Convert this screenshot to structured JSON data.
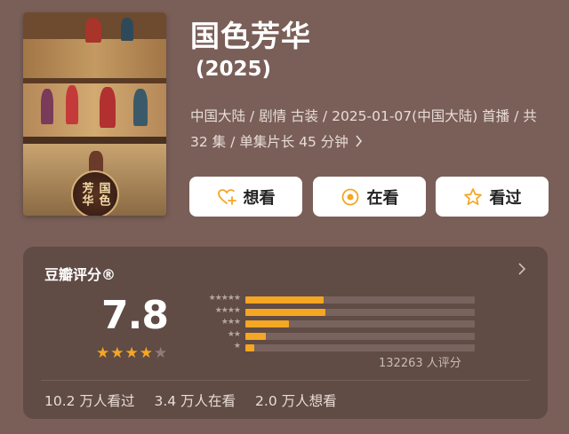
{
  "movie": {
    "title": "国色芳华",
    "year": "(2025)",
    "meta_line": "中国大陆 / 剧情 古装 / 2025-01-07(中国大陆) 首播 / 共 32 集 / 单集片长 45 分钟"
  },
  "poster": {
    "logo_text": "国色芳华"
  },
  "actions": {
    "want_label": "想看",
    "watching_label": "在看",
    "watched_label": "看过"
  },
  "rating": {
    "label": "豆瓣评分®",
    "score": "7.8",
    "stars_filled": 4,
    "stars_total": 5,
    "distribution": [
      {
        "stars": 5,
        "fraction": 0.34
      },
      {
        "stars": 4,
        "fraction": 0.35
      },
      {
        "stars": 3,
        "fraction": 0.19
      },
      {
        "stars": 2,
        "fraction": 0.09
      },
      {
        "stars": 1,
        "fraction": 0.04
      }
    ],
    "count_text": "132263 人评分"
  },
  "stats": {
    "watched": "10.2 万人看过",
    "watching": "3.4 万人在看",
    "want": "2.0 万人想看"
  },
  "colors": {
    "background": "#7a5f58",
    "accent": "#f5a623",
    "card": "#4a3a36"
  },
  "icons": {
    "want": "heart-plus-icon",
    "watching": "target-icon",
    "watched": "star-outline-icon",
    "more": "chevron-right-icon"
  }
}
